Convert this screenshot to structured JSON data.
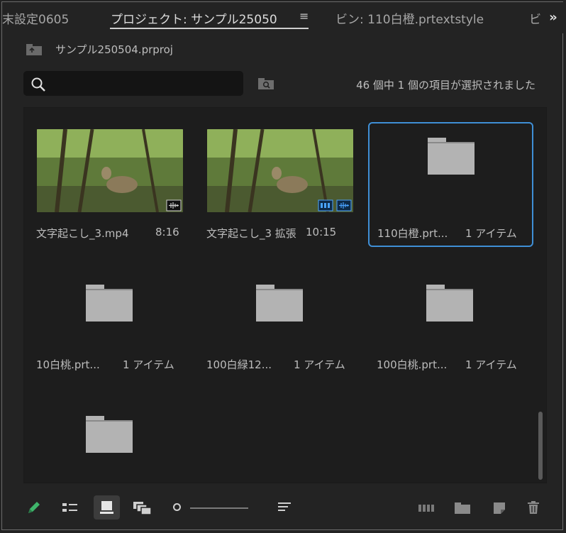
{
  "tabs": [
    {
      "label": "末設定0605"
    },
    {
      "label": "プロジェクト: サンプル25050"
    },
    {
      "label": "ビン: 110白橙.prtextstyle"
    },
    {
      "label": "ビ"
    }
  ],
  "tab_menu_icon": "≡",
  "overflow_icon": "»",
  "project": {
    "filename": "サンプル250504.prproj"
  },
  "search": {
    "placeholder": "",
    "value": ""
  },
  "status_text": "46 個中 1 個の項目が選択されました",
  "items": [
    {
      "name": "文字起こし_3.mp4",
      "meta": "8:16",
      "kind": "clip",
      "badges": [
        "audio"
      ]
    },
    {
      "name": "文字起こし_3 拡張",
      "meta": "10:15",
      "kind": "clip",
      "badges": [
        "video",
        "audio"
      ]
    },
    {
      "name": "110白橙.prt...",
      "meta": "1 アイテム",
      "kind": "bin",
      "selected": true
    },
    {
      "name": "10白桃.prt...",
      "meta": "1 アイテム",
      "kind": "bin"
    },
    {
      "name": "100白緑12...",
      "meta": "1 アイテム",
      "kind": "bin"
    },
    {
      "name": "100白桃.prt...",
      "meta": "1 アイテム",
      "kind": "bin"
    },
    {
      "name": "",
      "meta": "",
      "kind": "bin"
    }
  ],
  "footer": {
    "icons": [
      "pencil-icon",
      "list-view-icon",
      "icon-view-icon",
      "freeform-view-icon",
      "sort-icon",
      "automate-to-sequence-icon",
      "new-bin-icon",
      "new-item-icon",
      "trash-icon"
    ],
    "zoom_level": 0.05
  },
  "colors": {
    "accent": "#3f8fd6",
    "pencil": "#3fb56b",
    "badge": "#4aa3ff"
  }
}
